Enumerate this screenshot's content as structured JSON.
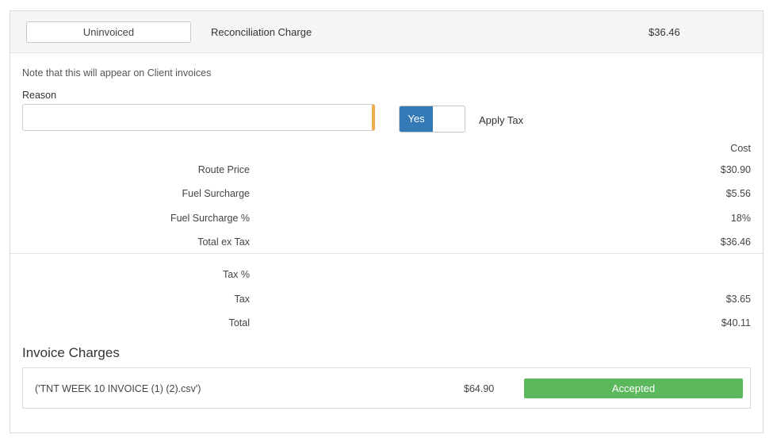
{
  "header": {
    "status_button": "Uninvoiced",
    "charge_label": "Reconciliation Charge",
    "charge_amount": "$36.46"
  },
  "form": {
    "note": "Note that this will appear on Client invoices",
    "reason_label": "Reason",
    "reason_value": "",
    "tax_toggle": {
      "on_label": "Yes",
      "state": "on"
    },
    "apply_tax_label": "Apply Tax"
  },
  "breakdown": {
    "column_header": "Cost",
    "rows": [
      {
        "label": "Route Price",
        "value": "$30.90"
      },
      {
        "label": "Fuel Surcharge",
        "value": "$5.56"
      },
      {
        "label": "Fuel Surcharge %",
        "value": "18%"
      },
      {
        "label": "Total ex Tax",
        "value": "$36.46"
      },
      {
        "label": "Tax %",
        "value": ""
      },
      {
        "label": "Tax",
        "value": "$3.65"
      },
      {
        "label": "Total",
        "value": "$40.11"
      }
    ]
  },
  "invoice_charges": {
    "title": "Invoice Charges",
    "items": [
      {
        "file": "('TNT WEEK 10 INVOICE (1) (2).csv')",
        "amount": "$64.90",
        "status": "Accepted"
      }
    ]
  },
  "colors": {
    "toggle_on": "#337ab7",
    "accepted": "#5cb85c",
    "input_accent": "#f0ad4e"
  }
}
